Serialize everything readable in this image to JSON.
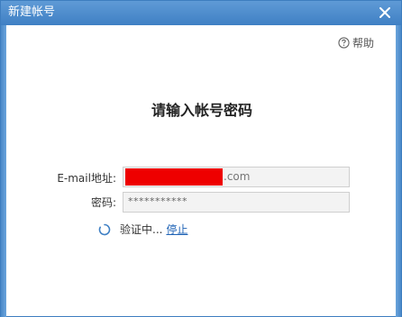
{
  "window": {
    "title": "新建帐号"
  },
  "help": {
    "label": "帮助"
  },
  "form": {
    "heading": "请输入帐号密码",
    "email_label": "E-mail地址:",
    "email_suffix": ".com",
    "password_label": "密码:",
    "password_value": "***********"
  },
  "status": {
    "text": "验证中...",
    "stop_label": "停止"
  },
  "colors": {
    "titlebar": "#4a89c8",
    "redaction": "#ee0000",
    "link": "#1e62b5"
  }
}
